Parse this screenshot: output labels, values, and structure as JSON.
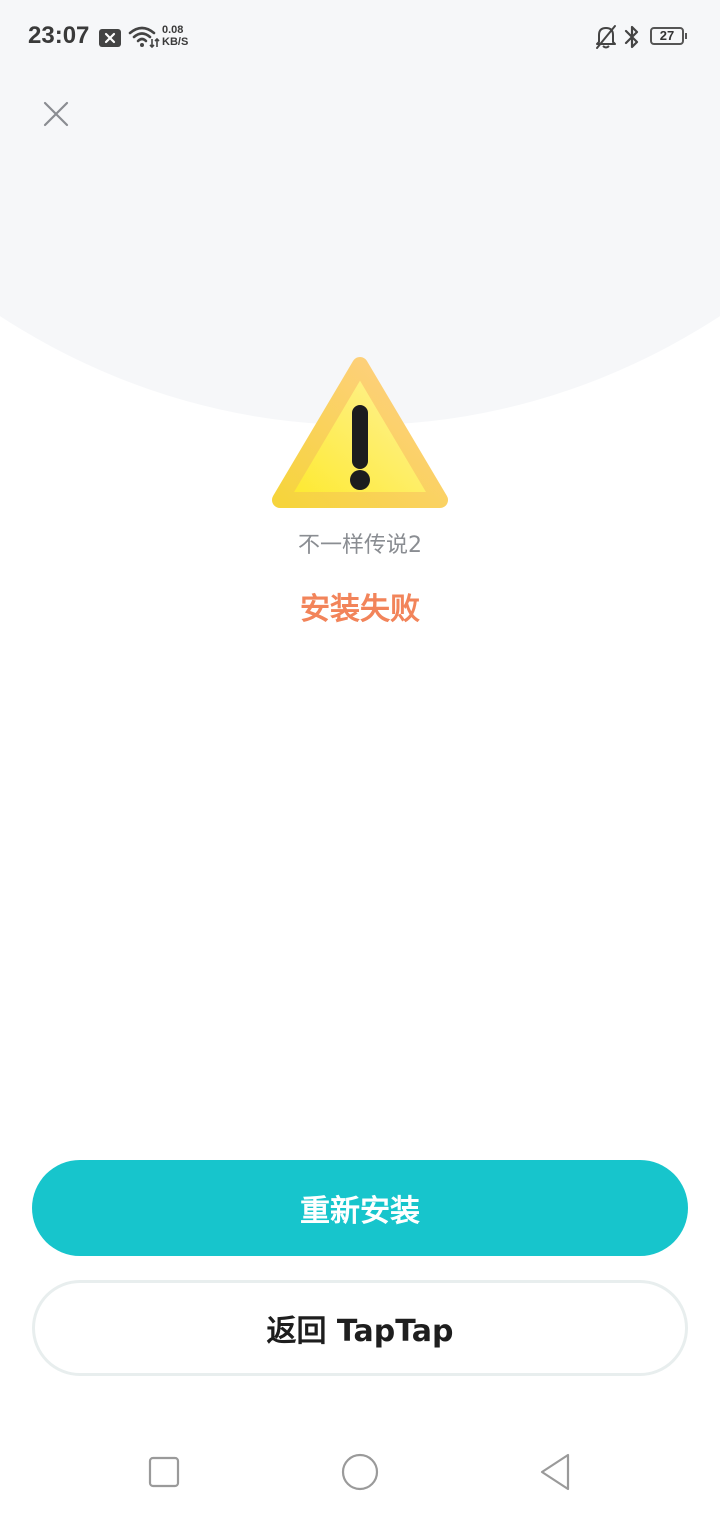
{
  "status_bar": {
    "time": "23:07",
    "net_speed_value": "0.08",
    "net_speed_unit": "KB/S",
    "battery_level": "27",
    "icons": [
      "notification-x-icon",
      "wifi-icon",
      "mute-bell-icon",
      "bluetooth-icon",
      "battery-icon"
    ]
  },
  "header": {
    "close_icon": "close-icon"
  },
  "main": {
    "icon": "warning-triangle-icon",
    "app_name": "不一样传说2",
    "status": "安装失败"
  },
  "actions": {
    "reinstall_label": "重新安装",
    "return_label": "返回 TapTap"
  },
  "nav": {
    "icons": [
      "recents-square-icon",
      "home-circle-icon",
      "back-triangle-icon"
    ]
  },
  "colors": {
    "accent": "#17c5cc",
    "error_text": "#f2845a",
    "background_top": "#f6f7f9"
  }
}
